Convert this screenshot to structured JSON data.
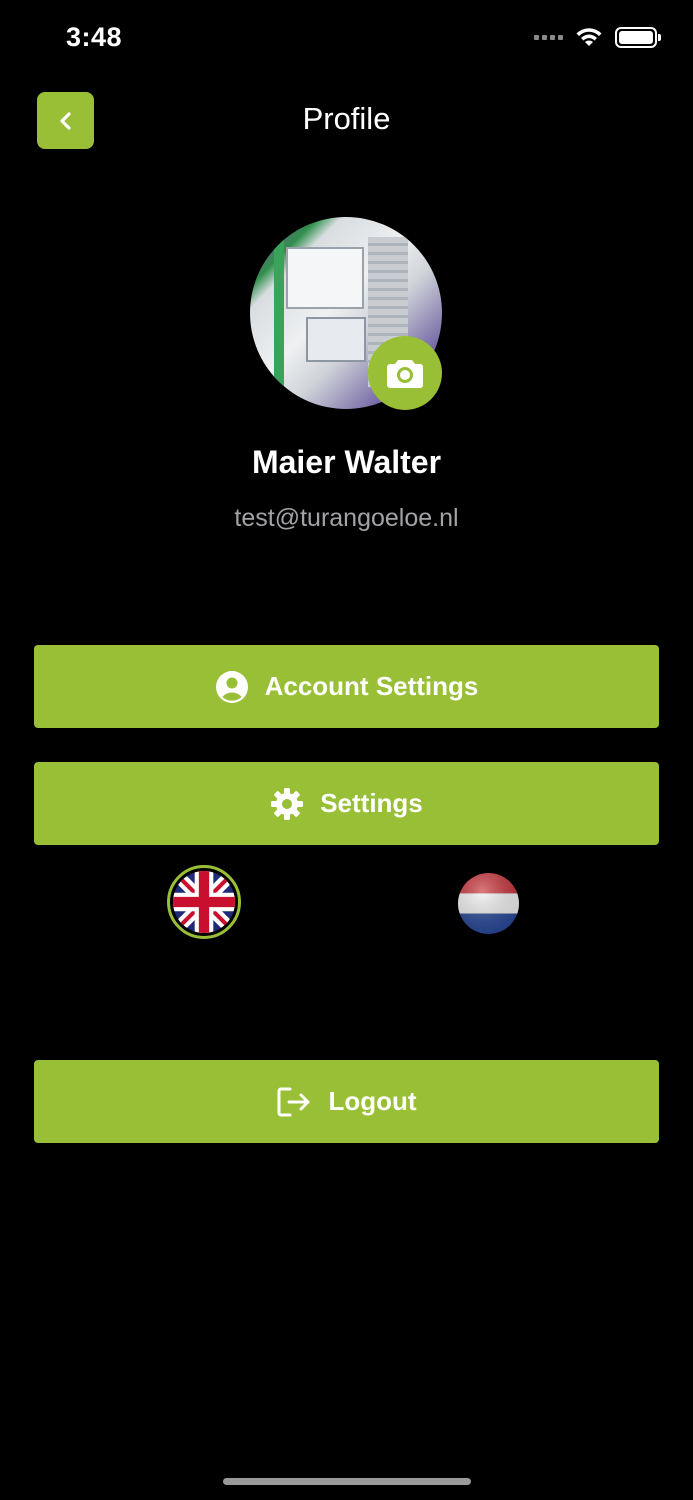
{
  "status_bar": {
    "time": "3:48",
    "icons": [
      "signal-icon",
      "wifi-icon",
      "battery-icon"
    ]
  },
  "header": {
    "title": "Profile",
    "back_icon": "chevron-left-icon"
  },
  "profile": {
    "name": "Maier Walter",
    "email": "test@turangoeloe.nl",
    "camera_icon": "camera-icon"
  },
  "actions": {
    "account_settings": {
      "label": "Account Settings",
      "icon": "user-circle-icon"
    },
    "settings": {
      "label": "Settings",
      "icon": "gear-icon"
    },
    "logout": {
      "label": "Logout",
      "icon": "logout-icon"
    }
  },
  "languages": {
    "options": [
      "uk-flag",
      "nl-flag"
    ],
    "selected": "uk-flag"
  },
  "colors": {
    "accent": "#98bf36",
    "background": "#000000",
    "muted_text": "#a3a3a7"
  }
}
